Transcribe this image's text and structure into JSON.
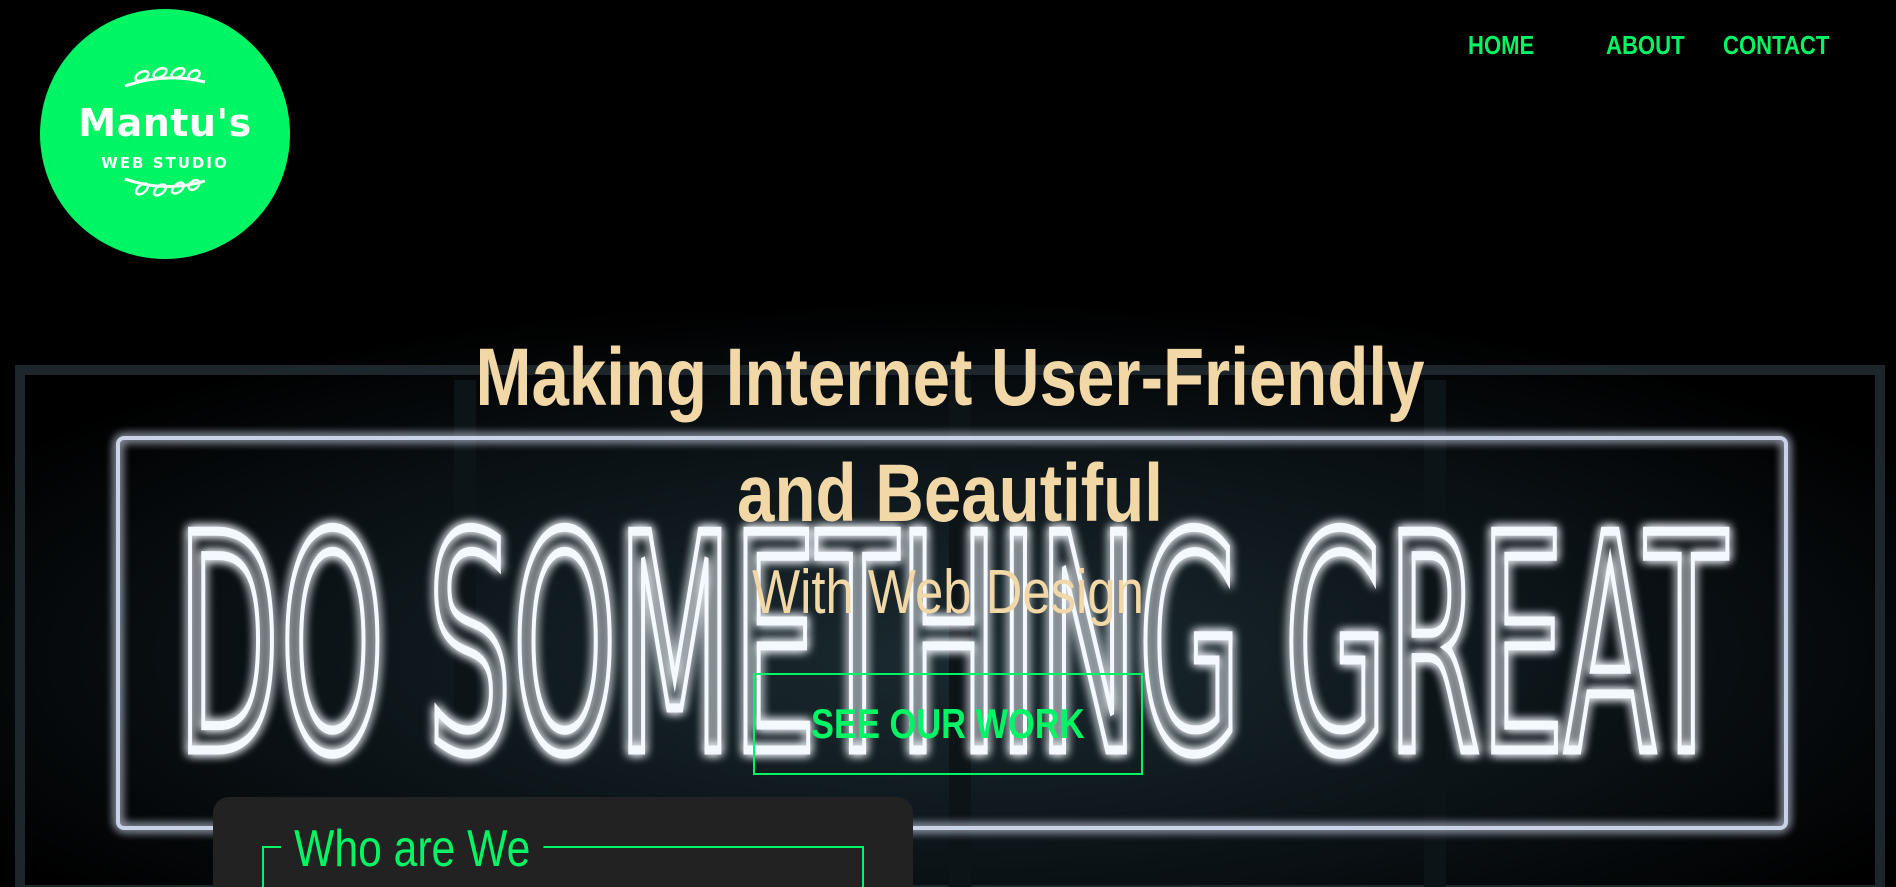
{
  "logo": {
    "brand": "Mantu's",
    "subtitle": "WEB STUDIO",
    "background_color": "#00f564"
  },
  "nav": {
    "home": "HOME",
    "about": "ABOUT",
    "contact": "CONTACT"
  },
  "hero": {
    "title": "Making Internet User-Friendly and Beautiful",
    "subtitle": "With Web Design",
    "cta_label": "SEE OUR WORK",
    "background_sign_text": "DO SOMETHING GREAT"
  },
  "about_card": {
    "title": "Who are We"
  },
  "colors": {
    "accent": "#00f564",
    "hero_text": "#f2d7a7",
    "card_bg": "#222222",
    "page_bg": "#000000"
  }
}
